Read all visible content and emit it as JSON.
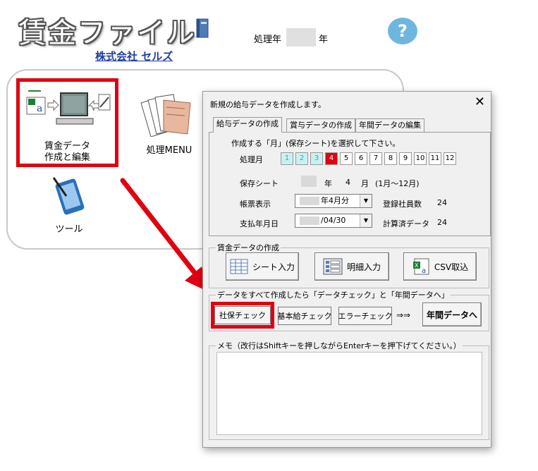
{
  "header": {
    "app_title": "賃金ファイル",
    "year_label": "処理年",
    "year_suffix": "年",
    "help_label": "?",
    "company": "株式会社 セルズ"
  },
  "main_menu": {
    "wage_item": {
      "line1": "賃金データ",
      "line2": "作成と編集"
    },
    "process_item": "処理MENU",
    "tool_item": "ツール"
  },
  "dialog": {
    "title": "新規の給与データを作成します。",
    "close": "✕",
    "tabs": [
      "給与データの作成",
      "賞与データの作成",
      "年間データの編集"
    ],
    "instruction": "作成する「月」(保存シート)を選択して下さい。",
    "month_label": "処理月",
    "months": [
      "1",
      "2",
      "3",
      "4",
      "5",
      "6",
      "7",
      "8",
      "9",
      "10",
      "11",
      "12"
    ],
    "current_month": "4",
    "save_sheet_label": "保存シート",
    "save_sheet_year": "年",
    "save_sheet_month": "4",
    "save_sheet_month_suffix": "月",
    "save_sheet_range": "(1月～12月)",
    "ledger_label": "帳票表示",
    "ledger_value": "年4月分",
    "registered_label": "登録社員数",
    "registered_value": "24",
    "payday_label": "支払年月日",
    "payday_value": "/04/30",
    "calculated_label": "計算済データ",
    "calculated_value": "24",
    "create_group_label": "賃金データの作成",
    "sheet_input_button": "シート入力",
    "detail_input_button": "明細入力",
    "csv_button": "CSV取込",
    "check_group_label": "データをすべて作成したら「データチェック」と「年間データへ」",
    "social_check_button": "社保チェック",
    "basic_check_button": "基本給チェック",
    "error_check_button": "エラーチェック",
    "arrows": "⇒⇒",
    "annual_button": "年間データへ",
    "memo_label": "メモ（改行はShiftキーを押しながらEnterキーを押下げてください。）",
    "memo_value": ""
  },
  "colors": {
    "highlight_red": "#e00010",
    "help_blue": "#6eb6de",
    "link_blue": "#1f3f9f",
    "done_month": "#c9f1f2"
  }
}
